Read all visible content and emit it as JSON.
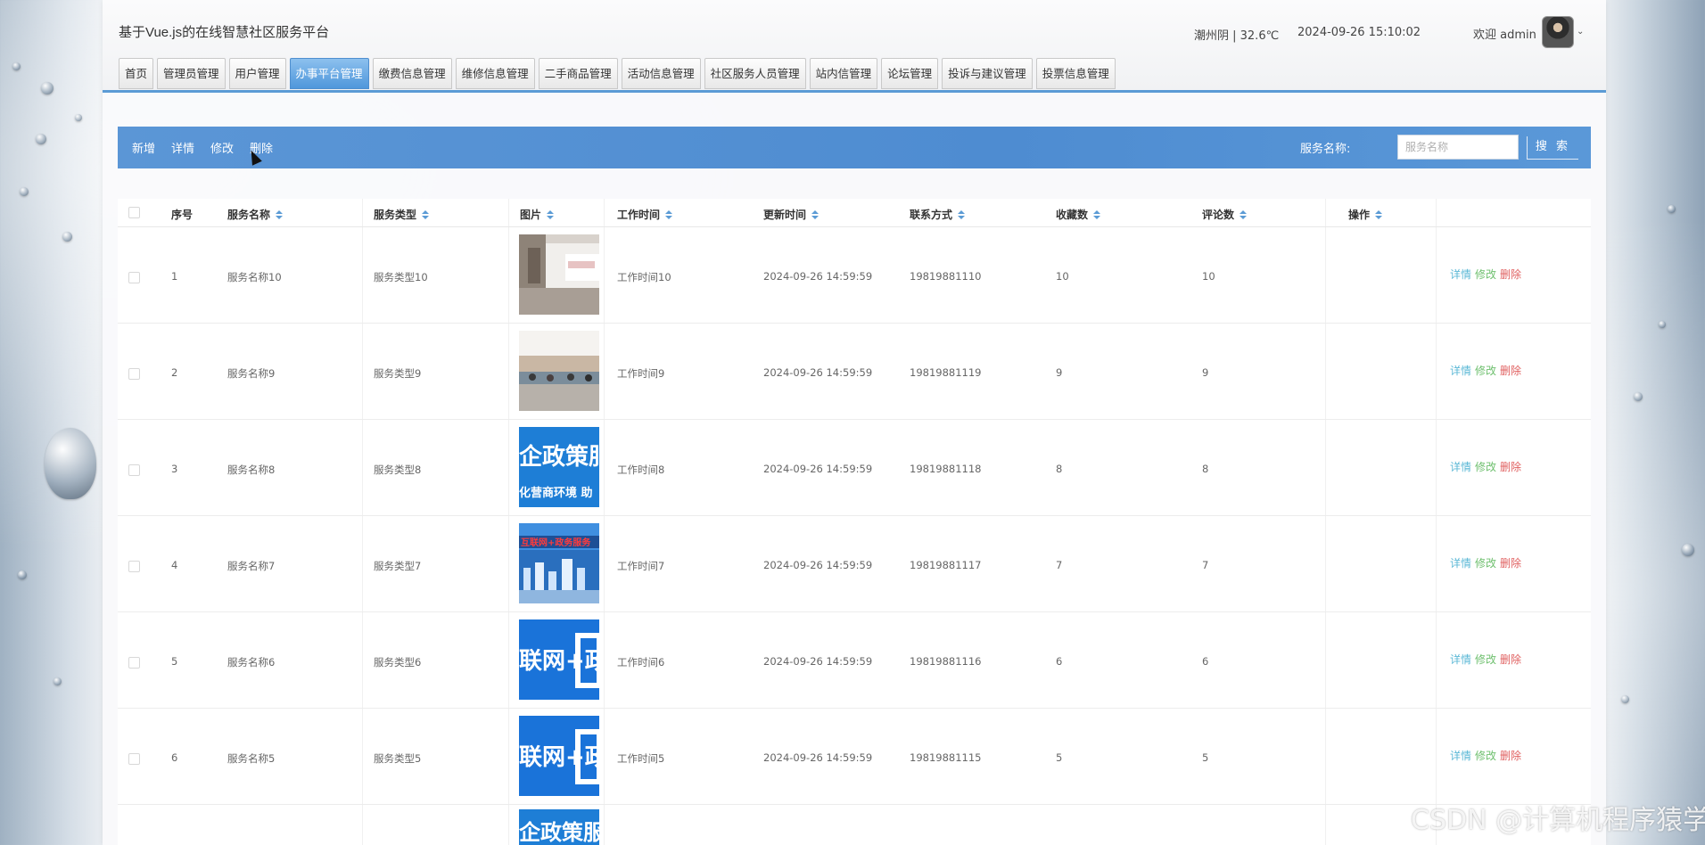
{
  "header": {
    "title": "基于Vue.js的在线智慧社区服务平台",
    "weather": "潮州阴 | 32.6℃",
    "datetime": "2024-09-26   15:10:02",
    "welcome": "欢迎 admin"
  },
  "nav": {
    "tabs": [
      "首页",
      "管理员管理",
      "用户管理",
      "办事平台管理",
      "缴费信息管理",
      "维修信息管理",
      "二手商品管理",
      "活动信息管理",
      "社区服务人员管理",
      "站内信管理",
      "论坛管理",
      "投诉与建议管理",
      "投票信息管理"
    ],
    "active": "办事平台管理"
  },
  "toolbar": {
    "add": "新增",
    "detail": "详情",
    "edit": "修改",
    "delete": "删除",
    "search_label": "服务名称:",
    "search_placeholder": "服务名称",
    "search_button": "搜 索"
  },
  "table": {
    "columns": [
      "序号",
      "服务名称",
      "服务类型",
      "图片",
      "工作时间",
      "更新时间",
      "联系方式",
      "收藏数",
      "评论数",
      "操作"
    ],
    "rows": [
      {
        "index": "1",
        "name": "服务名称10",
        "type": "服务类型10",
        "image": "office-hall",
        "worktime": "工作时间10",
        "updated": "2024-09-26 14:59:59",
        "contact": "19819881110",
        "fav": "10",
        "comments": "10"
      },
      {
        "index": "2",
        "name": "服务名称9",
        "type": "服务类型9",
        "image": "service-counter",
        "worktime": "工作时间9",
        "updated": "2024-09-26 14:59:59",
        "contact": "19819881119",
        "fav": "9",
        "comments": "9"
      },
      {
        "index": "3",
        "name": "服务名称8",
        "type": "服务类型8",
        "image": "policy-banner",
        "worktime": "工作时间8",
        "updated": "2024-09-26 14:59:59",
        "contact": "19819881118",
        "fav": "8",
        "comments": "8"
      },
      {
        "index": "4",
        "name": "服务名称7",
        "type": "服务类型7",
        "image": "city-map",
        "worktime": "工作时间7",
        "updated": "2024-09-26 14:59:59",
        "contact": "19819881117",
        "fav": "7",
        "comments": "7"
      },
      {
        "index": "5",
        "name": "服务名称6",
        "type": "服务类型6",
        "image": "internet-plus",
        "worktime": "工作时间6",
        "updated": "2024-09-26 14:59:59",
        "contact": "19819881116",
        "fav": "6",
        "comments": "6"
      },
      {
        "index": "6",
        "name": "服务名称5",
        "type": "服务类型5",
        "image": "internet-plus",
        "worktime": "工作时间5",
        "updated": "2024-09-26 14:59:59",
        "contact": "19819881115",
        "fav": "5",
        "comments": "5"
      }
    ],
    "row_actions": {
      "detail": "详情",
      "edit": "修改",
      "delete": "删除"
    },
    "thumb_texts": {
      "policy_top": "企政策服",
      "policy_bottom": "化营商环境 助",
      "internet": "联网+政",
      "map_banner": "互联网+政务服务"
    }
  },
  "watermark": "CSDN @计算机程序猿学长",
  "colors": {
    "accent": "#5b9bd5",
    "detail": "#5bb8d6",
    "edit": "#6fc06f",
    "delete": "#e06060"
  }
}
